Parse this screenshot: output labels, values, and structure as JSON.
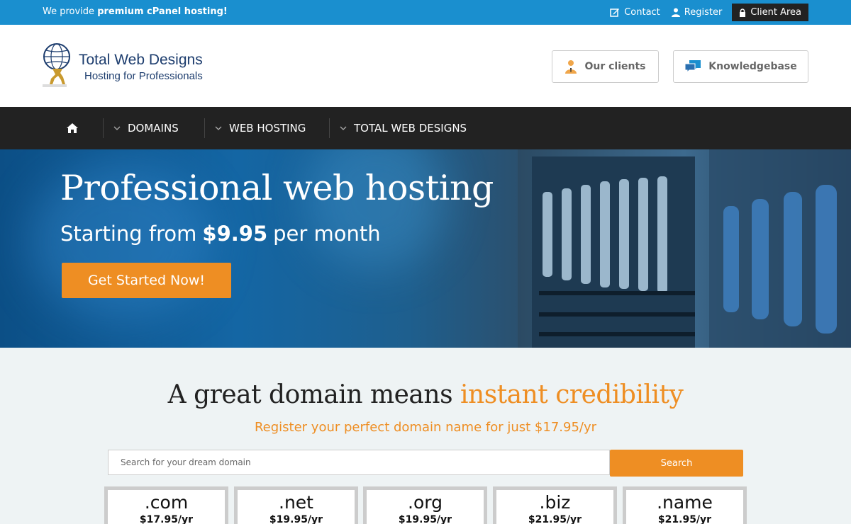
{
  "topbar": {
    "promo_prefix": "We provide ",
    "promo_bold": "premium cPanel hosting!",
    "links": {
      "contact": "Contact",
      "register": "Register",
      "client_area": "Client Area"
    }
  },
  "header": {
    "logo_title": "Total Web Designs",
    "logo_subtitle": "Hosting for Professionals",
    "btn_clients": "Our clients",
    "btn_kb": "Knowledgebase"
  },
  "nav": {
    "items": [
      "DOMAINS",
      "WEB HOSTING",
      "TOTAL WEB DESIGNS"
    ]
  },
  "hero": {
    "title": "Professional web hosting",
    "sub_prefix": "Starting from",
    "price": "$9.95",
    "sub_suffix": "per month",
    "cta": "Get Started Now!"
  },
  "domain": {
    "title_plain": "A great domain means ",
    "title_highlight": "instant credibility",
    "subtitle": "Register your perfect domain name for just $17.95/yr",
    "search_placeholder": "Search for your dream domain",
    "search_button": "Search",
    "tlds": [
      {
        "ext": ".com",
        "price": "$17.95/yr"
      },
      {
        "ext": ".net",
        "price": "$19.95/yr"
      },
      {
        "ext": ".org",
        "price": "$19.95/yr"
      },
      {
        "ext": ".biz",
        "price": "$21.95/yr"
      },
      {
        "ext": ".name",
        "price": "$21.95/yr"
      }
    ]
  },
  "colors": {
    "topbar": "#1a8fcf",
    "accent": "#ee8e23",
    "nav": "#222222"
  }
}
